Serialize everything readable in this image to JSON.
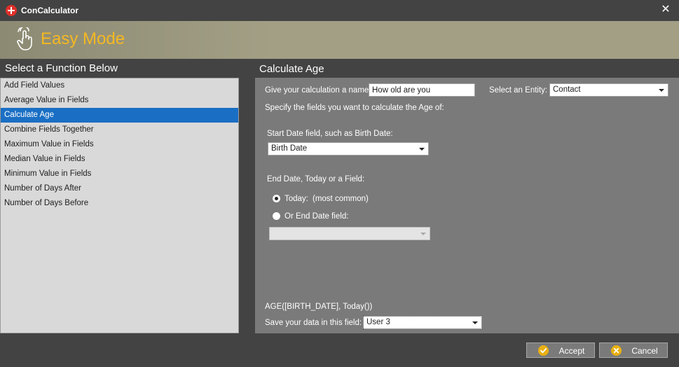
{
  "window": {
    "title": "ConCalculator",
    "close_glyph": "✕",
    "mode_title": "Easy Mode"
  },
  "left": {
    "header": "Select a Function Below",
    "functions": [
      "Add Field Values",
      "Average Value in Fields",
      "Calculate Age",
      "Combine Fields Together",
      "Maximum Value in Fields",
      "Median Value in Fields",
      "Minimum Value in Fields",
      "Number of Days After",
      "Number of Days Before"
    ],
    "selected": "Calculate Age"
  },
  "right": {
    "header": "Calculate Age",
    "name_label": "Give your calculation a name:",
    "name_value": "How old are you",
    "entity_label": "Select an Entity:",
    "entity_value": "Contact",
    "specify_label": "Specify the fields you want to calculate the Age of:",
    "start_label": "Start Date field, such as Birth Date:",
    "start_value": "Birth Date",
    "end_label": "End Date, Today or a Field:",
    "today_label": "Today:",
    "today_hint": "(most common)",
    "end_field_label": "Or End Date field:",
    "end_field_value": "",
    "formula": "AGE([BIRTH_DATE], Today())",
    "save_label": "Save your data in this field:",
    "save_value": "User 3"
  },
  "buttons": {
    "accept": "Accept",
    "cancel": "Cancel"
  },
  "colors": {
    "background": "#434343",
    "banner": "#a29f85",
    "accent": "#f4b823",
    "selection": "#1a6fc4",
    "panel": "#7a7a7a",
    "list": "#d9d9d9"
  },
  "icons": {
    "app": "calculator-app-icon",
    "close": "close-icon",
    "mode": "hand-gesture-icon",
    "accept": "check-circle-icon",
    "cancel": "x-circle-icon"
  }
}
